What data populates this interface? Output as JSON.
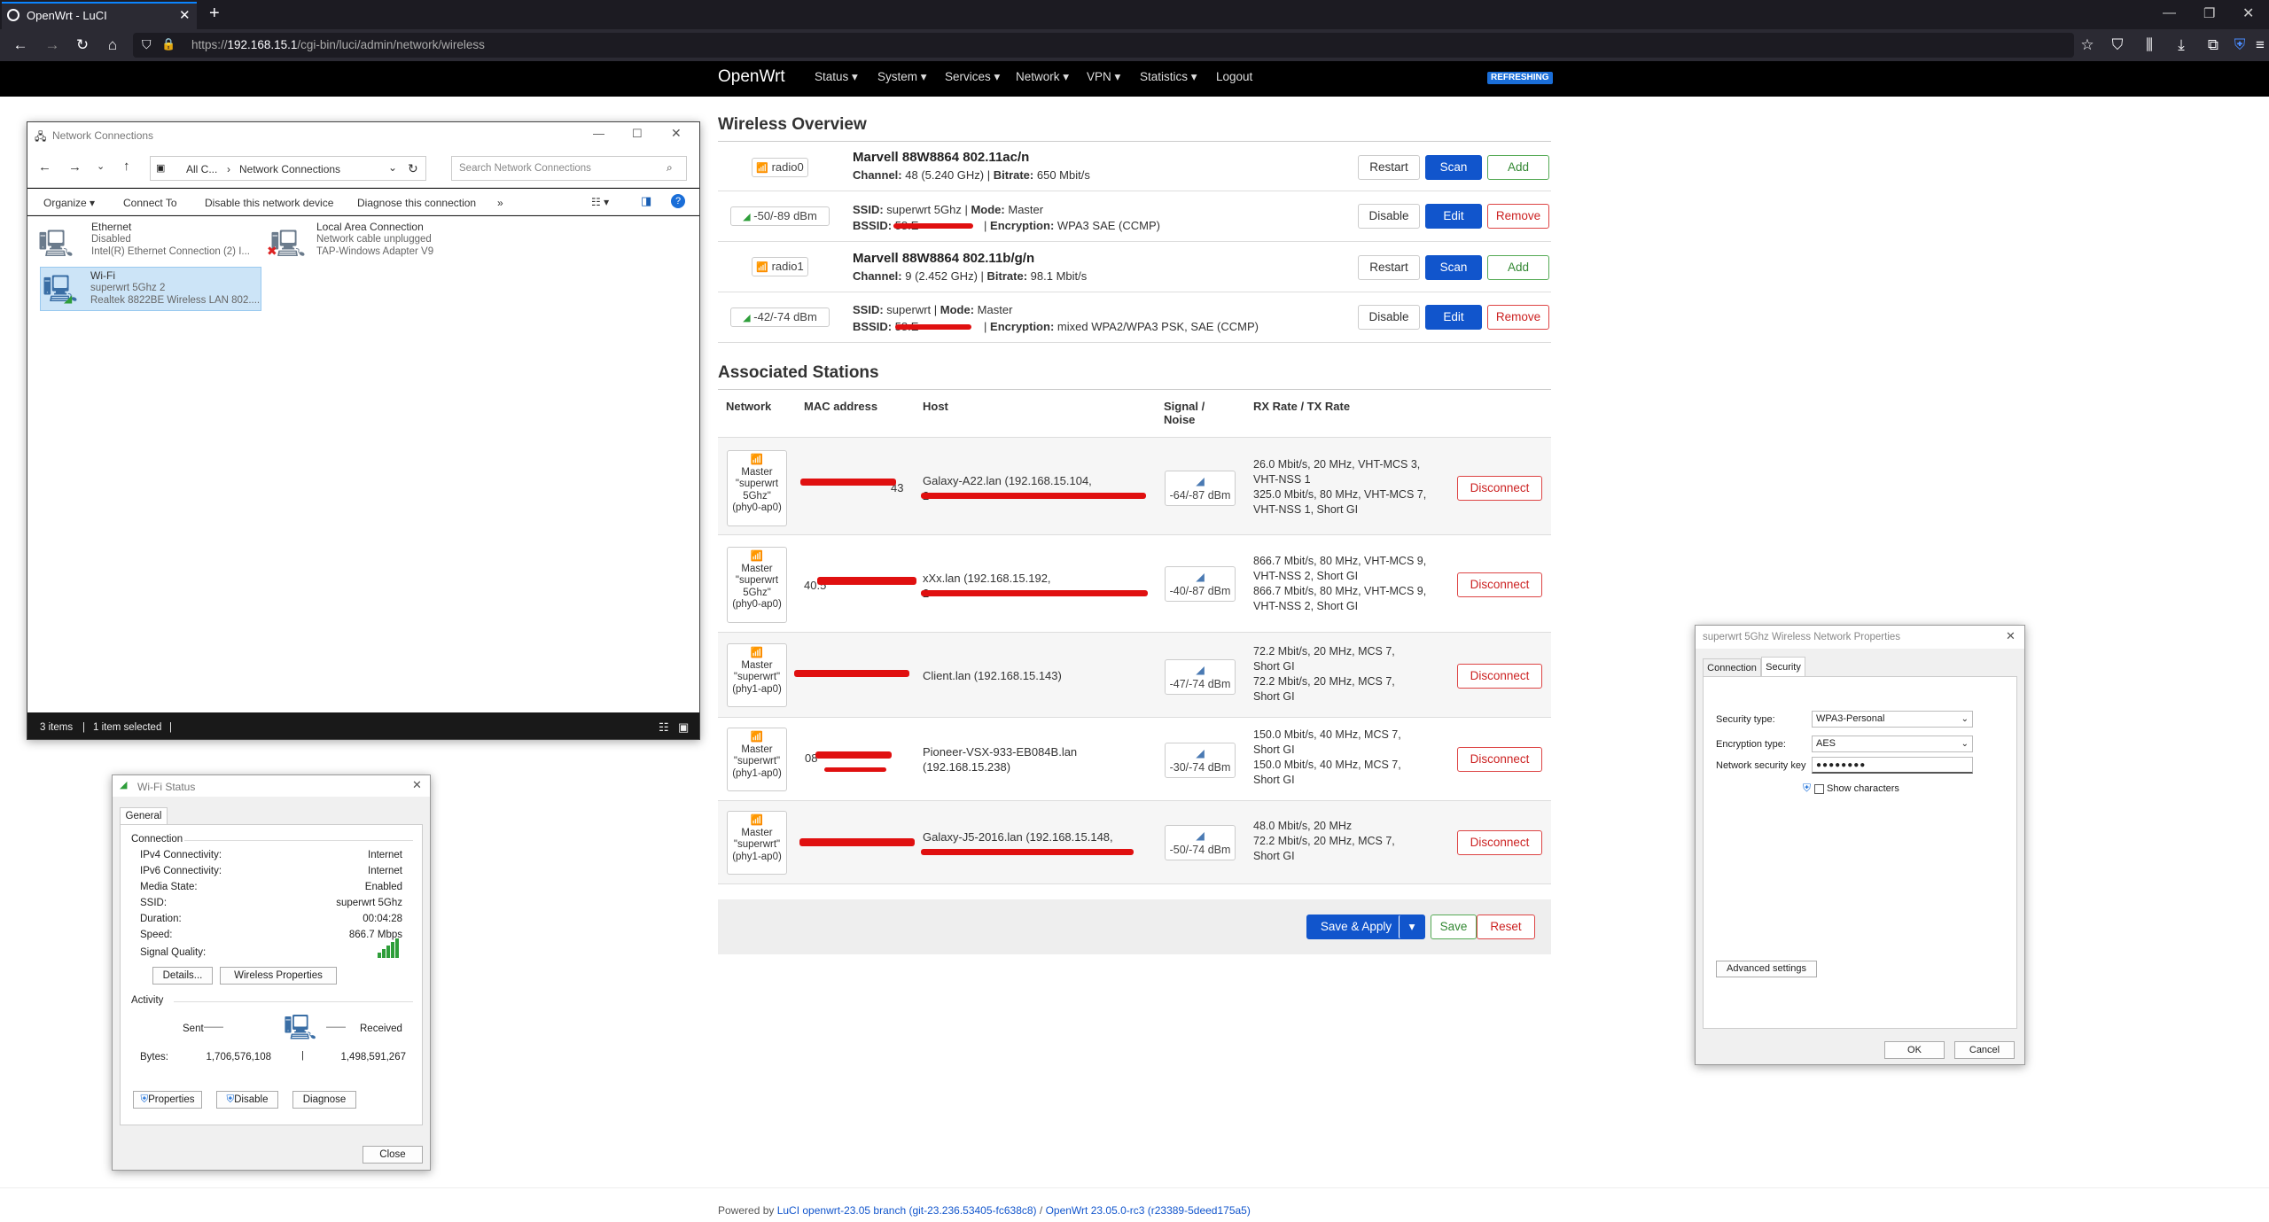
{
  "browser": {
    "tab_title": "OpenWrt - LuCI",
    "url_prefix": "https://",
    "url_host": "192.168.15.1",
    "url_path": "/cgi-bin/luci/admin/network/wireless"
  },
  "luci": {
    "brand": "OpenWrt",
    "menu": [
      "Status ▾",
      "System ▾",
      "Services ▾",
      "Network ▾",
      "VPN ▾",
      "Statistics ▾",
      "Logout"
    ],
    "badge": "REFRESHING"
  },
  "overview": {
    "title": "Wireless Overview",
    "rows": [
      {
        "badge": "radio0",
        "title": "Marvell 88W8864 802.11ac/n",
        "line1_label": "Channel:",
        "line1_val": "48 (5.240 GHz)",
        "line1_sep": " | ",
        "line1_label2": "Bitrate:",
        "line1_val2": "650 Mbit/s",
        "buttons": [
          "Restart",
          "Scan",
          "Add"
        ]
      },
      {
        "badge": "-50/-89 dBm",
        "title_label": "SSID:",
        "title_val": "superwrt 5Ghz",
        "title_sep": " | ",
        "title_label2": "Mode:",
        "title_val2": "Master",
        "line1_label": "BSSID:",
        "line1_val": "58:E",
        "line1_label2": "Encryption:",
        "line1_val2": "WPA3 SAE (CCMP)",
        "buttons": [
          "Disable",
          "Edit",
          "Remove"
        ]
      },
      {
        "badge": "radio1",
        "title": "Marvell 88W8864 802.11b/g/n",
        "line1_label": "Channel:",
        "line1_val": "9 (2.452 GHz)",
        "line1_sep": " | ",
        "line1_label2": "Bitrate:",
        "line1_val2": "98.1 Mbit/s",
        "buttons": [
          "Restart",
          "Scan",
          "Add"
        ]
      },
      {
        "badge": "-42/-74 dBm",
        "title_label": "SSID:",
        "title_val": "superwrt",
        "title_sep": " | ",
        "title_label2": "Mode:",
        "title_val2": "Master",
        "line1_label": "BSSID:",
        "line1_val": "58:E",
        "line1_label2": "Encryption:",
        "line1_val2": "mixed WPA2/WPA3 PSK, SAE (CCMP)",
        "buttons": [
          "Disable",
          "Edit",
          "Remove"
        ]
      }
    ]
  },
  "stations": {
    "title": "Associated Stations",
    "headers": [
      "Network",
      "MAC address",
      "Host",
      "Signal / Noise",
      "RX Rate / TX Rate"
    ],
    "rows": [
      {
        "net": [
          "Master",
          "\"superwrt",
          "5Ghz\"",
          "(phy0-ap0)"
        ],
        "mac": "43",
        "host": [
          "Galaxy-A22.lan (192.168.15.104,",
          "2"
        ],
        "signal": "-64/-87 dBm",
        "rate": [
          "26.0 Mbit/s, 20 MHz, VHT-MCS 3,",
          "VHT-NSS 1",
          "325.0 Mbit/s, 80 MHz, VHT-MCS 7,",
          "VHT-NSS 1, Short GI"
        ],
        "btn": "Disconnect"
      },
      {
        "net": [
          "Master",
          "\"superwrt",
          "5Ghz\"",
          "(phy0-ap0)"
        ],
        "mac": "40:5",
        "host": [
          "xXx.lan (192.168.15.192,",
          "2"
        ],
        "signal": "-40/-87 dBm",
        "rate": [
          "866.7 Mbit/s, 80 MHz, VHT-MCS 9,",
          "VHT-NSS 2, Short GI",
          "866.7 Mbit/s, 80 MHz, VHT-MCS 9,",
          "VHT-NSS 2, Short GI"
        ],
        "btn": "Disconnect"
      },
      {
        "net": [
          "Master",
          "\"superwrt\"",
          "(phy1-ap0)"
        ],
        "mac": "",
        "host": [
          "Client.lan (192.168.15.143)"
        ],
        "signal": "-47/-74 dBm",
        "rate": [
          "72.2 Mbit/s, 20 MHz, MCS 7,",
          "Short GI",
          "72.2 Mbit/s, 20 MHz, MCS 7,",
          "Short GI"
        ],
        "btn": "Disconnect"
      },
      {
        "net": [
          "Master",
          "\"superwrt\"",
          "(phy1-ap0)"
        ],
        "mac": "08",
        "host": [
          "Pioneer-VSX-933-EB084B.lan",
          "(192.168.15.238)"
        ],
        "signal": "-30/-74 dBm",
        "rate": [
          "150.0 Mbit/s, 40 MHz, MCS 7,",
          "Short GI",
          "150.0 Mbit/s, 40 MHz, MCS 7,",
          "Short GI"
        ],
        "btn": "Disconnect"
      },
      {
        "net": [
          "Master",
          "\"superwrt\"",
          "(phy1-ap0)"
        ],
        "mac": "",
        "host": [
          "Galaxy-J5-2016.lan (192.168.15.148,",
          ""
        ],
        "signal": "-50/-74 dBm",
        "rate": [
          "48.0 Mbit/s, 20 MHz",
          "72.2 Mbit/s, 20 MHz, MCS 7,",
          "Short GI"
        ],
        "btn": "Disconnect"
      }
    ]
  },
  "actions": {
    "save_apply": "Save & Apply",
    "save": "Save",
    "reset": "Reset"
  },
  "footer": {
    "prefix": "Powered by ",
    "link1": "LuCI openwrt-23.05 branch (git-23.236.53405-fc638c8)",
    "sep": " / ",
    "link2": "OpenWrt 23.05.0-rc3 (r23389-5deed175a5)"
  },
  "netconn": {
    "title": "Network Connections",
    "crumb1": "All C...",
    "crumb2": "Network Connections",
    "search_placeholder": "Search Network Connections",
    "toolbar": [
      "Organize ▾",
      "Connect To",
      "Disable this network device",
      "Diagnose this connection",
      "»"
    ],
    "items": [
      {
        "name": "Ethernet",
        "l2": "Disabled",
        "l3": "Intel(R) Ethernet Connection (2) I..."
      },
      {
        "name": "Local Area Connection",
        "l2": "Network cable unplugged",
        "l3": "TAP-Windows Adapter V9"
      },
      {
        "name": "Wi-Fi",
        "l2": "superwrt 5Ghz 2",
        "l3": "Realtek 8822BE Wireless LAN 802...."
      }
    ],
    "status_items": "3 items",
    "status_selected": "1 item selected"
  },
  "wifistatus": {
    "title": "Wi-Fi Status",
    "tab": "General",
    "connection": "Connection",
    "rows": [
      [
        "IPv4 Connectivity:",
        "Internet"
      ],
      [
        "IPv6 Connectivity:",
        "Internet"
      ],
      [
        "Media State:",
        "Enabled"
      ],
      [
        "SSID:",
        "superwrt 5Ghz"
      ],
      [
        "Duration:",
        "00:04:28"
      ],
      [
        "Speed:",
        "866.7 Mbps"
      ]
    ],
    "signal_label": "Signal Quality:",
    "details": "Details...",
    "wireless_props": "Wireless Properties",
    "activity": "Activity",
    "sent": "Sent",
    "received": "Received",
    "bytes_label": "Bytes:",
    "bytes_sent": "1,706,576,108",
    "bytes_recv": "1,498,591,267",
    "properties": "Properties",
    "disable": "Disable",
    "diagnose": "Diagnose",
    "close": "Close"
  },
  "wprops": {
    "title": "superwrt 5Ghz Wireless Network Properties",
    "tab1": "Connection",
    "tab2": "Security",
    "sec_type_label": "Security type:",
    "sec_type": "WPA3-Personal",
    "enc_type_label": "Encryption type:",
    "enc_type": "AES",
    "key_label": "Network security key",
    "key": "●●●●●●●●",
    "show_chars": "Show characters",
    "advanced": "Advanced settings",
    "ok": "OK",
    "cancel": "Cancel"
  },
  "colors": {
    "luci_blue": "#1155cc",
    "signal_green": "#2e9e3a",
    "redaction": "#e01010"
  }
}
